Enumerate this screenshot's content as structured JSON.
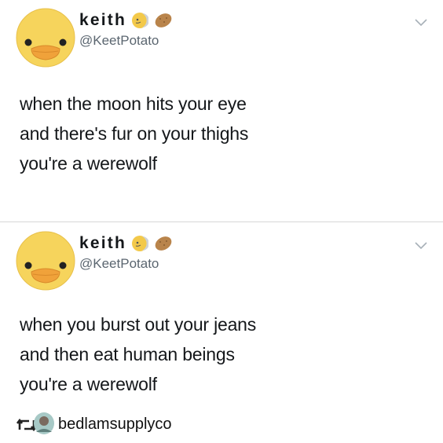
{
  "tweets": [
    {
      "name": "keith",
      "handle": "@KeetPotato",
      "lines": [
        "when the moon hits your eye",
        "and there's fur on your thighs",
        "you're a werewolf"
      ],
      "name_emojis": [
        "moon-emoji",
        "potato-emoji"
      ]
    },
    {
      "name": "keith",
      "handle": "@KeetPotato",
      "lines": [
        "when you burst out your jeans",
        "and then eat human beings",
        "you're a werewolf"
      ],
      "name_emojis": [
        "moon-emoji",
        "potato-emoji"
      ]
    }
  ],
  "repost": {
    "username": "bedlamsupplyco",
    "icon": "retweet-icon"
  },
  "colors": {
    "text": "#14171a",
    "handle": "#5b6670",
    "avatar": "#f5cf5a",
    "beak": "#f0a23a"
  }
}
